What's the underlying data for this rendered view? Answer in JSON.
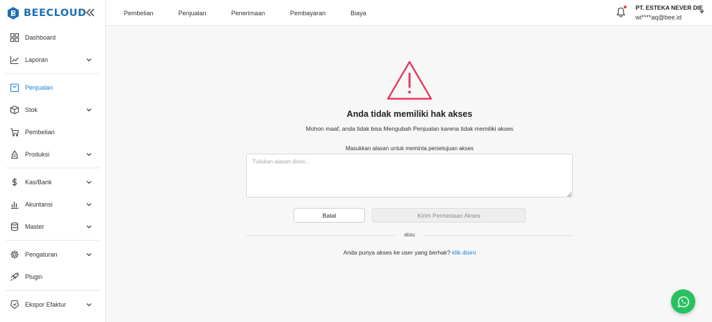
{
  "brand": {
    "name": "BEECLOUD",
    "color": "#1f6fb2"
  },
  "sidebar": {
    "items": [
      {
        "label": "Dashboard",
        "icon": "dashboard-icon",
        "expandable": false
      },
      {
        "label": "Laporan",
        "icon": "chart-icon",
        "expandable": true
      },
      {
        "label": "Penjualan",
        "icon": "sales-icon",
        "expandable": false,
        "active": true
      },
      {
        "label": "Stok",
        "icon": "box-icon",
        "expandable": true
      },
      {
        "label": "Pembelian",
        "icon": "cart-icon",
        "expandable": false
      },
      {
        "label": "Produksi",
        "icon": "factory-icon",
        "expandable": true
      },
      {
        "label": "Kas/Bank",
        "icon": "dollar-icon",
        "expandable": true
      },
      {
        "label": "Akuntansi",
        "icon": "bars-icon",
        "expandable": true
      },
      {
        "label": "Master",
        "icon": "database-icon",
        "expandable": true
      },
      {
        "label": "Pengaturan",
        "icon": "gear-icon",
        "expandable": true
      },
      {
        "label": "Plugin",
        "icon": "plugin-icon",
        "expandable": false
      },
      {
        "label": "Ekspor Efaktur",
        "icon": "export-icon",
        "expandable": true
      }
    ]
  },
  "topnav": {
    "items": [
      "Pembelian",
      "Penjualan",
      "Penerimaan",
      "Pembayaran",
      "Biaya"
    ]
  },
  "account": {
    "company": "PT. ESTEKA NEVER DIE",
    "email": "wi****aq@bee.id"
  },
  "main": {
    "title": "Anda tidak memiliki hak akses",
    "subtitle": "Mohon maaf, anda tidak bisa Mengubah Penjualan karena tidak memiliki akses",
    "prompt": "Masukkan alasan untuk meminta persetujuan akses",
    "reason_placeholder": "Tuliskan alasan disini...",
    "cancel_label": "Batal",
    "send_label": "Kirim Permintaan Akses",
    "or_label": "atau",
    "access_text": "Anda punya akses ke user yang berhak?",
    "access_link": "klik disini"
  },
  "colors": {
    "accent": "#1a7fd4",
    "warning": "#e53960",
    "whatsapp": "#29c160"
  }
}
